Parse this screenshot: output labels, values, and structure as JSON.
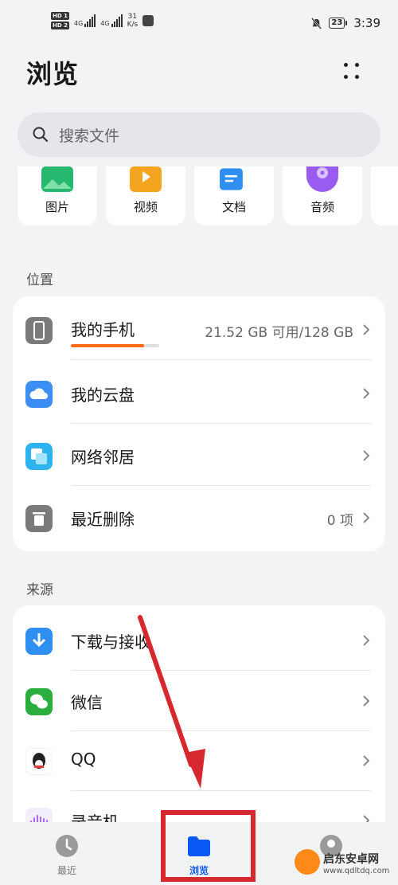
{
  "status_bar": {
    "hd1": "HD 1",
    "hd2": "HD 2",
    "net1": "4G",
    "net2": "4G",
    "speed_value": "31",
    "speed_unit": "K/s",
    "battery": "23",
    "time": "3:39"
  },
  "header": {
    "title": "浏览",
    "more_icon": "more-dots-icon"
  },
  "search": {
    "placeholder": "搜索文件",
    "icon": "search-icon"
  },
  "categories": [
    {
      "label": "图片",
      "icon": "image-icon",
      "color": "#25b86e"
    },
    {
      "label": "视频",
      "icon": "video-icon",
      "color": "#f5a41f"
    },
    {
      "label": "文档",
      "icon": "document-icon",
      "color": "#2f8ff0"
    },
    {
      "label": "音频",
      "icon": "audio-icon",
      "color": "#9a5cf0"
    }
  ],
  "locations": {
    "title": "位置",
    "items": [
      {
        "label": "我的手机",
        "meta": "21.52 GB 可用/128 GB",
        "icon": "phone-icon",
        "color": "#7a7a7a",
        "used_fraction": 0.832
      },
      {
        "label": "我的云盘",
        "meta": "",
        "icon": "cloud-icon",
        "color": "#3c8ef5"
      },
      {
        "label": "网络邻居",
        "meta": "",
        "icon": "network-icon",
        "color": "#2db4f0"
      },
      {
        "label": "最近删除",
        "meta": "0 项",
        "icon": "trash-icon",
        "color": "#7a7a7a"
      }
    ]
  },
  "sources": {
    "title": "来源",
    "items": [
      {
        "label": "下载与接收",
        "icon": "download-icon",
        "color": "#2f8ff0"
      },
      {
        "label": "微信",
        "icon": "wechat-icon",
        "color": "#2aae3e"
      },
      {
        "label": "QQ",
        "icon": "qq-icon",
        "color": "#222222"
      },
      {
        "label": "录音机",
        "icon": "recorder-icon",
        "color": "#b06cf0"
      }
    ]
  },
  "bottom_nav": {
    "items": [
      {
        "label": "最近",
        "icon": "clock-icon",
        "active": false
      },
      {
        "label": "浏览",
        "icon": "folder-icon",
        "active": true
      },
      {
        "label": "",
        "icon": "user-icon",
        "active": false
      }
    ]
  },
  "watermark": {
    "name": "启东安卓网",
    "url": "www.qdltdq.com"
  },
  "colors": {
    "accent": "#0a59f7",
    "annotation": "#d6282f",
    "storage": "#ff6a1a"
  }
}
